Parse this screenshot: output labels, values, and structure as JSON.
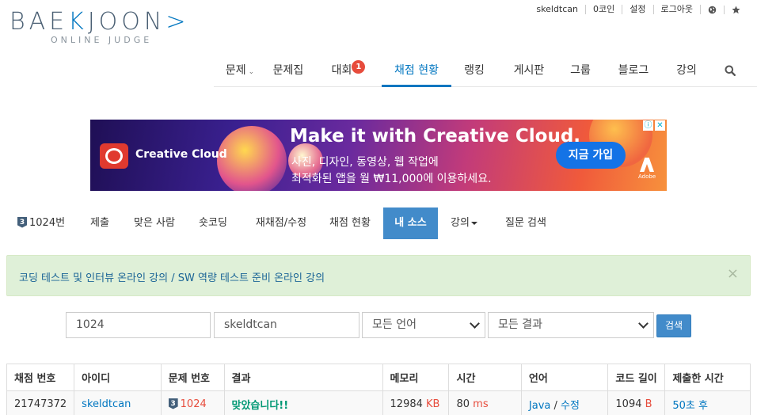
{
  "logo": {
    "main_left": "BAE",
    "main_k": "K",
    "main_right": "JOON",
    "tagline": "ONLINE JUDGE"
  },
  "userbar": {
    "username": "skeldtcan",
    "coins": "0코인",
    "settings": "설정",
    "logout": "로그아웃"
  },
  "mainnav": {
    "items": [
      {
        "label": "문제",
        "has_dropdown": true
      },
      {
        "label": "문제집"
      },
      {
        "label": "대회",
        "badge": "1"
      },
      {
        "label": "채점 현황",
        "active": true
      },
      {
        "label": "랭킹"
      },
      {
        "label": "게시판"
      },
      {
        "label": "그룹"
      },
      {
        "label": "블로그"
      },
      {
        "label": "강의"
      }
    ]
  },
  "ad": {
    "brand": "Creative Cloud",
    "headline": "Make it with Creative Cloud.",
    "line1": "사진, 디자인, 동영상, 웹 작업에",
    "line2": "최적화된 앱을 월 ₩11,000에 이용하세요.",
    "cta": "지금 가입",
    "company": "Adobe"
  },
  "subnav": {
    "items": [
      {
        "label": "1024번",
        "level": "3"
      },
      {
        "label": "제출"
      },
      {
        "label": "맞은 사람"
      },
      {
        "label": "숏코딩"
      },
      {
        "label": "재채점/수정"
      },
      {
        "label": "채점 현황"
      },
      {
        "label": "내 소스",
        "active": true
      },
      {
        "label": "강의",
        "has_dropdown": true
      },
      {
        "label": "질문 검색"
      }
    ]
  },
  "alert": {
    "text": "코딩 테스트 및 인터뷰 온라인 강의 / SW 역량 테스트 준비 온라인 강의",
    "close": "×"
  },
  "search": {
    "problem_value": "1024",
    "user_value": "skeldtcan",
    "language": "모든 언어",
    "result": "모든 결과",
    "button": "검색"
  },
  "table": {
    "headers": [
      "채점 번호",
      "아이디",
      "문제 번호",
      "결과",
      "메모리",
      "시간",
      "언어",
      "코드 길이",
      "제출한 시간"
    ],
    "rows": [
      {
        "id": "21747372",
        "user": "skeldtcan",
        "problem_level": "3",
        "problem": "1024",
        "result": "맞았습니다!!",
        "memory": "12984",
        "memory_unit": "KB",
        "time": "80",
        "time_unit": "ms",
        "language": "Java",
        "sep": "/",
        "edit": "수정",
        "code_length": "1094",
        "code_unit": "B",
        "submitted": "50초 후"
      }
    ]
  },
  "colors": {
    "accent": "#0076c0",
    "active_tab": "#428bca",
    "ok": "#009874",
    "error": "#e74c3c",
    "alert_bg": "#dff0d8"
  }
}
